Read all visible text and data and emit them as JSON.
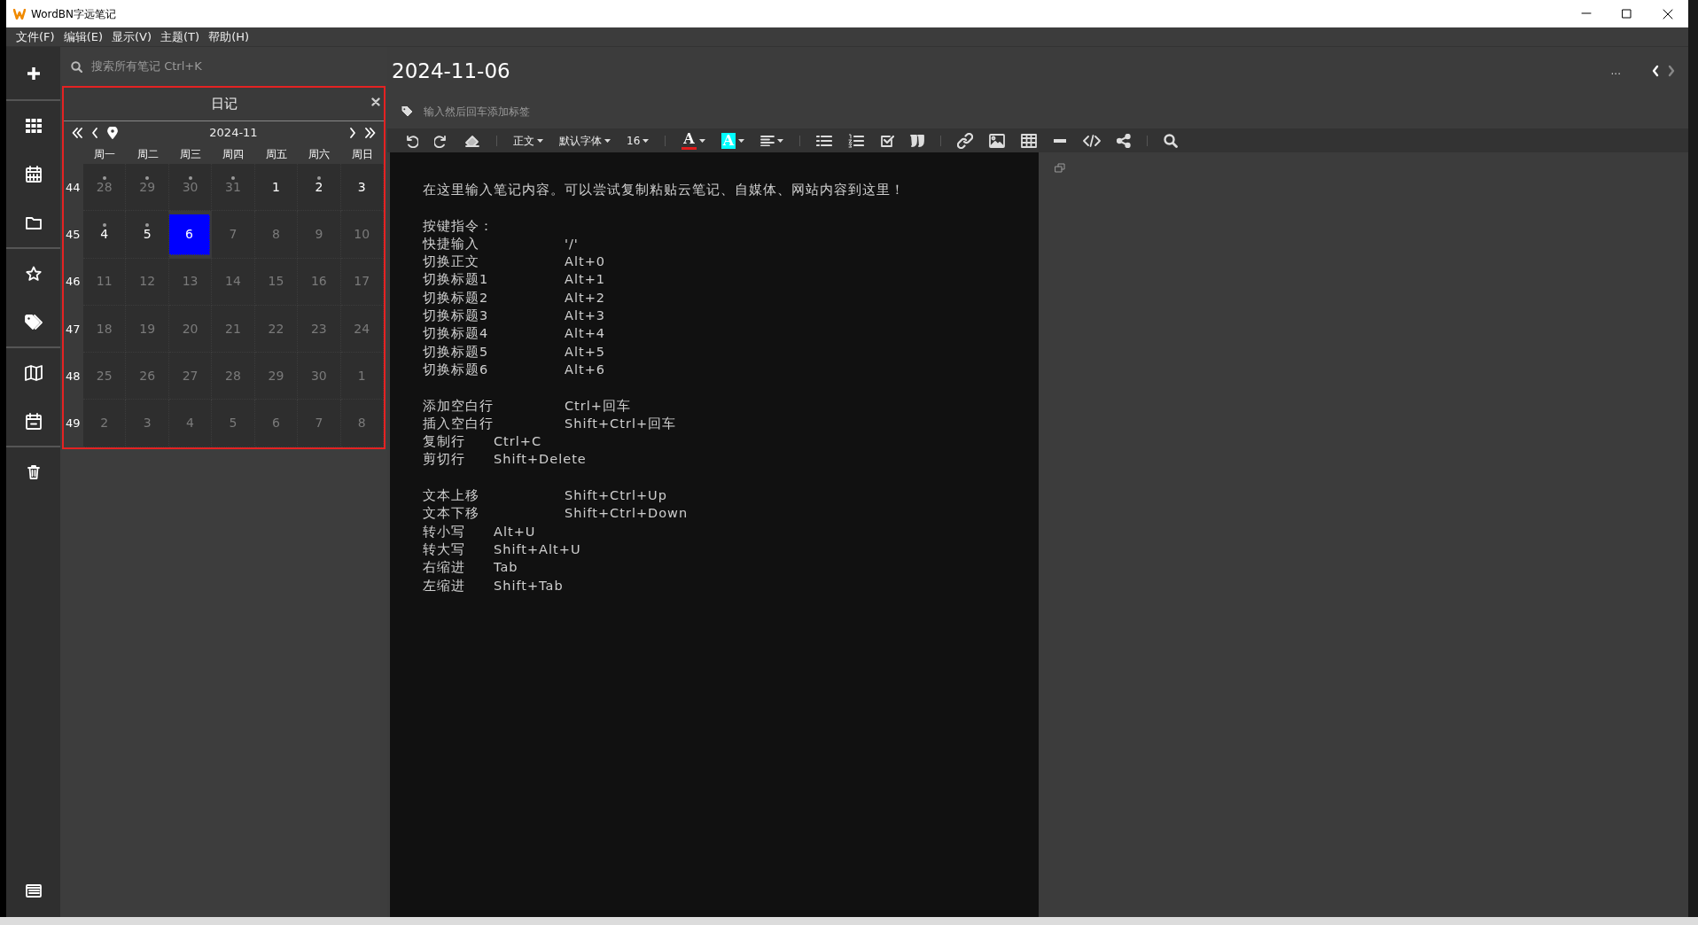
{
  "window": {
    "title": "WordBN字远笔记"
  },
  "menu": [
    "文件(F)",
    "编辑(E)",
    "显示(V)",
    "主题(T)",
    "帮助(H)"
  ],
  "search": {
    "placeholder": "搜索所有笔记 Ctrl+K"
  },
  "calendar": {
    "title": "日记",
    "month": "2024-11",
    "weekdays": [
      "周一",
      "周二",
      "周三",
      "周四",
      "周五",
      "周六",
      "周日"
    ],
    "weeks": [
      {
        "number": "44",
        "days": [
          {
            "label": "28",
            "muted": true,
            "has_note": true,
            "selected": false
          },
          {
            "label": "29",
            "muted": true,
            "has_note": true,
            "selected": false
          },
          {
            "label": "30",
            "muted": true,
            "has_note": true,
            "selected": false
          },
          {
            "label": "31",
            "muted": true,
            "has_note": true,
            "selected": false
          },
          {
            "label": "1",
            "muted": false,
            "has_note": false,
            "selected": false
          },
          {
            "label": "2",
            "muted": false,
            "has_note": true,
            "selected": false
          },
          {
            "label": "3",
            "muted": false,
            "has_note": false,
            "selected": false
          }
        ]
      },
      {
        "number": "45",
        "days": [
          {
            "label": "4",
            "muted": false,
            "has_note": true,
            "selected": false
          },
          {
            "label": "5",
            "muted": false,
            "has_note": true,
            "selected": false
          },
          {
            "label": "6",
            "muted": false,
            "has_note": false,
            "selected": true
          },
          {
            "label": "7",
            "muted": true,
            "has_note": false,
            "selected": false
          },
          {
            "label": "8",
            "muted": true,
            "has_note": false,
            "selected": false
          },
          {
            "label": "9",
            "muted": true,
            "has_note": false,
            "selected": false
          },
          {
            "label": "10",
            "muted": true,
            "has_note": false,
            "selected": false
          }
        ]
      },
      {
        "number": "46",
        "days": [
          {
            "label": "11",
            "muted": true,
            "has_note": false,
            "selected": false
          },
          {
            "label": "12",
            "muted": true,
            "has_note": false,
            "selected": false
          },
          {
            "label": "13",
            "muted": true,
            "has_note": false,
            "selected": false
          },
          {
            "label": "14",
            "muted": true,
            "has_note": false,
            "selected": false
          },
          {
            "label": "15",
            "muted": true,
            "has_note": false,
            "selected": false
          },
          {
            "label": "16",
            "muted": true,
            "has_note": false,
            "selected": false
          },
          {
            "label": "17",
            "muted": true,
            "has_note": false,
            "selected": false
          }
        ]
      },
      {
        "number": "47",
        "days": [
          {
            "label": "18",
            "muted": true,
            "has_note": false,
            "selected": false
          },
          {
            "label": "19",
            "muted": true,
            "has_note": false,
            "selected": false
          },
          {
            "label": "20",
            "muted": true,
            "has_note": false,
            "selected": false
          },
          {
            "label": "21",
            "muted": true,
            "has_note": false,
            "selected": false
          },
          {
            "label": "22",
            "muted": true,
            "has_note": false,
            "selected": false
          },
          {
            "label": "23",
            "muted": true,
            "has_note": false,
            "selected": false
          },
          {
            "label": "24",
            "muted": true,
            "has_note": false,
            "selected": false
          }
        ]
      },
      {
        "number": "48",
        "days": [
          {
            "label": "25",
            "muted": true,
            "has_note": false,
            "selected": false
          },
          {
            "label": "26",
            "muted": true,
            "has_note": false,
            "selected": false
          },
          {
            "label": "27",
            "muted": true,
            "has_note": false,
            "selected": false
          },
          {
            "label": "28",
            "muted": true,
            "has_note": false,
            "selected": false
          },
          {
            "label": "29",
            "muted": true,
            "has_note": false,
            "selected": false
          },
          {
            "label": "30",
            "muted": true,
            "has_note": false,
            "selected": false
          },
          {
            "label": "1",
            "muted": true,
            "has_note": false,
            "selected": false
          }
        ]
      },
      {
        "number": "49",
        "days": [
          {
            "label": "2",
            "muted": true,
            "has_note": false,
            "selected": false
          },
          {
            "label": "3",
            "muted": true,
            "has_note": false,
            "selected": false
          },
          {
            "label": "4",
            "muted": true,
            "has_note": false,
            "selected": false
          },
          {
            "label": "5",
            "muted": true,
            "has_note": false,
            "selected": false
          },
          {
            "label": "6",
            "muted": true,
            "has_note": false,
            "selected": false
          },
          {
            "label": "7",
            "muted": true,
            "has_note": false,
            "selected": false
          },
          {
            "label": "8",
            "muted": true,
            "has_note": false,
            "selected": false
          }
        ]
      }
    ]
  },
  "note": {
    "title": "2024-11-06",
    "more": "...",
    "prev_disabled": false,
    "next_disabled": true,
    "tags": {
      "placeholder": "输入然后回车添加标签"
    },
    "toolbar": {
      "paragraph_style": "正文",
      "font_family": "默认字体",
      "font_size": "16",
      "text_color": {
        "glyph": "A",
        "color": "#e01b1b"
      },
      "highlight": {
        "glyph": "A",
        "color": "#00ffff"
      }
    },
    "blocks": [
      {
        "lines": [
          {
            "kind": "text",
            "text": "在这里输入笔记内容。可以尝试复制粘贴云笔记、自媒体、网站内容到这里！"
          }
        ]
      },
      {
        "lines": [
          {
            "kind": "text",
            "text": "按键指令："
          },
          {
            "kind": "wide",
            "label": "快捷输入",
            "shortcut": "'/'"
          },
          {
            "kind": "wide",
            "label": "切换正文",
            "shortcut": "Alt+0"
          },
          {
            "kind": "wide",
            "label": "切换标题1",
            "shortcut": "Alt+1"
          },
          {
            "kind": "wide",
            "label": "切换标题2",
            "shortcut": "Alt+2"
          },
          {
            "kind": "wide",
            "label": "切换标题3",
            "shortcut": "Alt+3"
          },
          {
            "kind": "wide",
            "label": "切换标题4",
            "shortcut": "Alt+4"
          },
          {
            "kind": "wide",
            "label": "切换标题5",
            "shortcut": "Alt+5"
          },
          {
            "kind": "wide",
            "label": "切换标题6",
            "shortcut": "Alt+6"
          }
        ]
      },
      {
        "lines": [
          {
            "kind": "wide",
            "label": "添加空白行",
            "shortcut": "Ctrl+回车"
          },
          {
            "kind": "wide",
            "label": "插入空白行",
            "shortcut": "Shift+Ctrl+回车"
          },
          {
            "kind": "narrow",
            "label": "复制行",
            "shortcut": "Ctrl+C"
          },
          {
            "kind": "narrow",
            "label": "剪切行",
            "shortcut": "Shift+Delete"
          }
        ]
      },
      {
        "lines": [
          {
            "kind": "wide",
            "label": "文本上移",
            "shortcut": "Shift+Ctrl+Up"
          },
          {
            "kind": "wide",
            "label": "文本下移",
            "shortcut": "Shift+Ctrl+Down"
          },
          {
            "kind": "narrow",
            "label": "转小写",
            "shortcut": "Alt+U"
          },
          {
            "kind": "narrow",
            "label": "转大写",
            "shortcut": "Shift+Alt+U"
          },
          {
            "kind": "narrow",
            "label": "右缩进",
            "shortcut": "Tab"
          },
          {
            "kind": "narrow",
            "label": "左缩进",
            "shortcut": "Shift+Tab"
          }
        ]
      }
    ]
  }
}
